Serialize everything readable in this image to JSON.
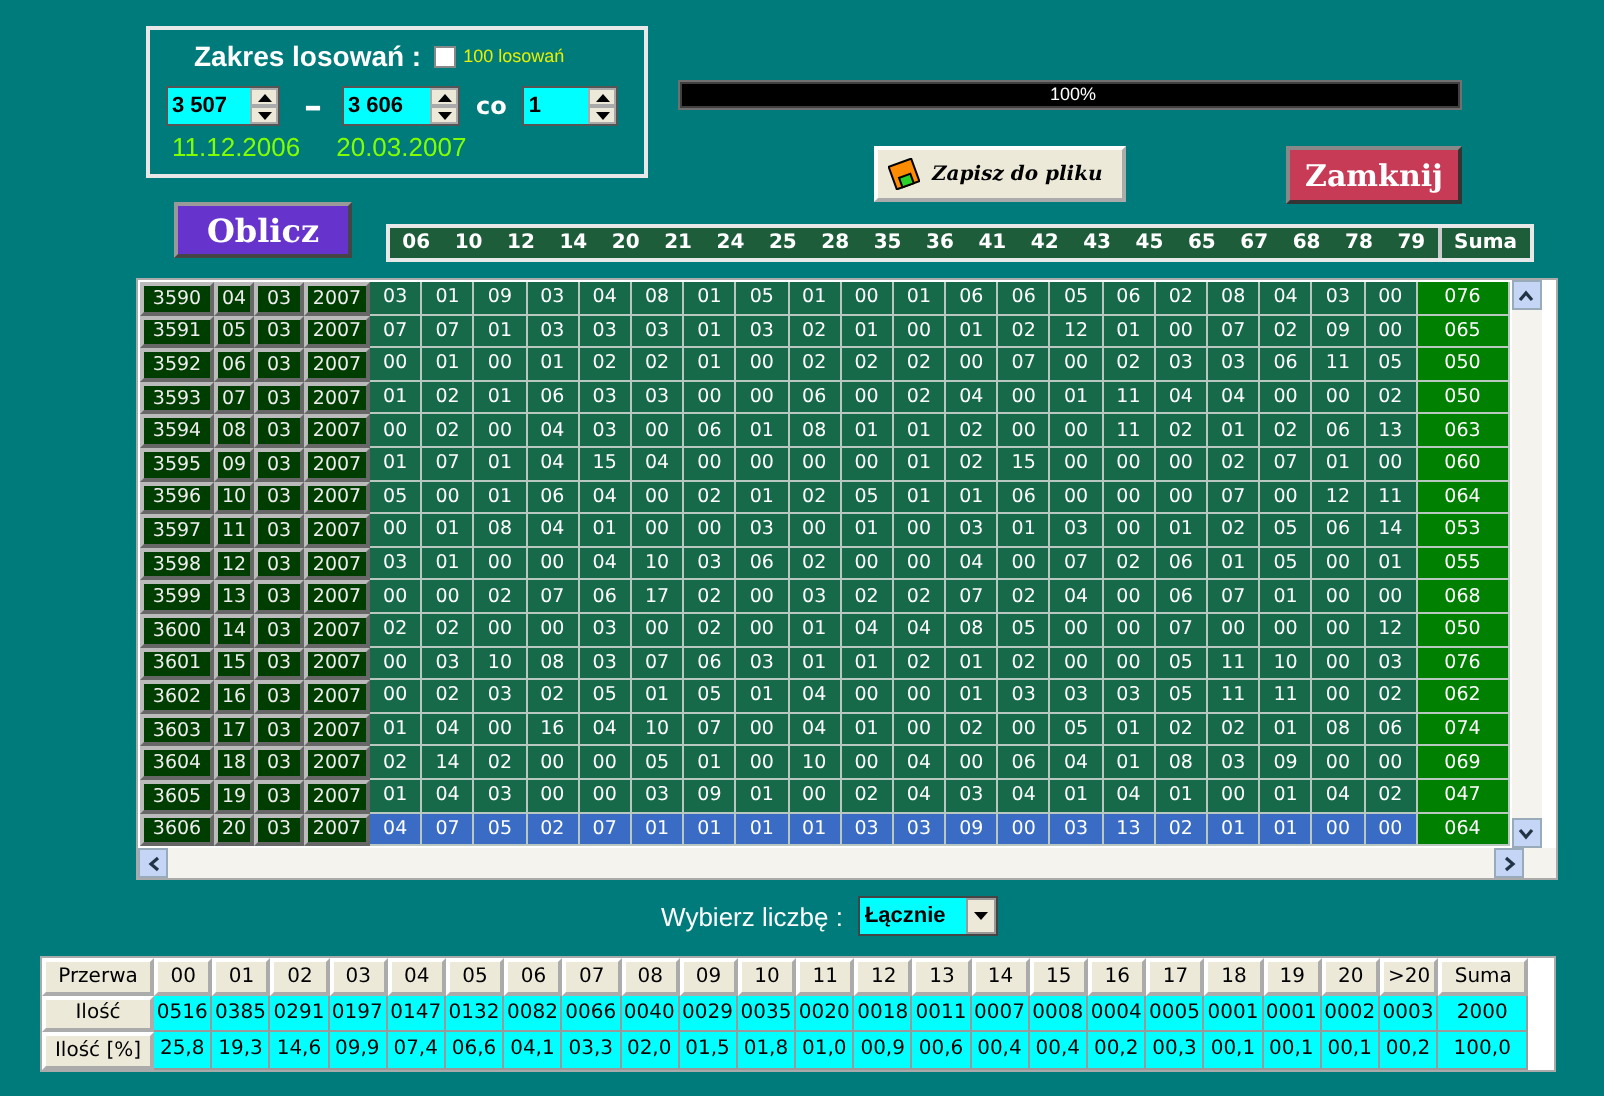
{
  "range_panel": {
    "title": "Zakres losowań :",
    "checkbox": {
      "label": "100 losowań",
      "checked": false
    },
    "from": "3 507",
    "separator": "–",
    "to": "3 606",
    "step_label": "co",
    "step": "1",
    "date_from": "11.12.2006",
    "date_to": "20.03.2007"
  },
  "progress": {
    "level": 1,
    "text": "100%"
  },
  "buttons": {
    "save": "Zapisz do pliku",
    "close": "Zamknij",
    "calculate": "Oblicz"
  },
  "columns": [
    "06",
    "10",
    "12",
    "14",
    "20",
    "21",
    "24",
    "25",
    "28",
    "35",
    "36",
    "41",
    "42",
    "43",
    "45",
    "65",
    "67",
    "68",
    "78",
    "79"
  ],
  "sum_label": "Suma",
  "rows": [
    {
      "id": "3590",
      "day": "04",
      "month": "03",
      "year": "2007",
      "values": [
        "03",
        "01",
        "09",
        "03",
        "04",
        "08",
        "01",
        "05",
        "01",
        "00",
        "01",
        "06",
        "06",
        "05",
        "06",
        "02",
        "08",
        "04",
        "03",
        "00"
      ],
      "sum": "076",
      "selected": false
    },
    {
      "id": "3591",
      "day": "05",
      "month": "03",
      "year": "2007",
      "values": [
        "07",
        "07",
        "01",
        "03",
        "03",
        "03",
        "01",
        "03",
        "02",
        "01",
        "00",
        "01",
        "02",
        "12",
        "01",
        "00",
        "07",
        "02",
        "09",
        "00"
      ],
      "sum": "065",
      "selected": false
    },
    {
      "id": "3592",
      "day": "06",
      "month": "03",
      "year": "2007",
      "values": [
        "00",
        "01",
        "00",
        "01",
        "02",
        "02",
        "01",
        "00",
        "02",
        "02",
        "02",
        "00",
        "07",
        "00",
        "02",
        "03",
        "03",
        "06",
        "11",
        "05"
      ],
      "sum": "050",
      "selected": false
    },
    {
      "id": "3593",
      "day": "07",
      "month": "03",
      "year": "2007",
      "values": [
        "01",
        "02",
        "01",
        "06",
        "03",
        "03",
        "00",
        "00",
        "06",
        "00",
        "02",
        "04",
        "00",
        "01",
        "11",
        "04",
        "04",
        "00",
        "00",
        "02"
      ],
      "sum": "050",
      "selected": false
    },
    {
      "id": "3594",
      "day": "08",
      "month": "03",
      "year": "2007",
      "values": [
        "00",
        "02",
        "00",
        "04",
        "03",
        "00",
        "06",
        "01",
        "08",
        "01",
        "01",
        "02",
        "00",
        "00",
        "11",
        "02",
        "01",
        "02",
        "06",
        "13"
      ],
      "sum": "063",
      "selected": false
    },
    {
      "id": "3595",
      "day": "09",
      "month": "03",
      "year": "2007",
      "values": [
        "01",
        "07",
        "01",
        "04",
        "15",
        "04",
        "00",
        "00",
        "00",
        "00",
        "01",
        "02",
        "15",
        "00",
        "00",
        "00",
        "02",
        "07",
        "01",
        "00"
      ],
      "sum": "060",
      "selected": false
    },
    {
      "id": "3596",
      "day": "10",
      "month": "03",
      "year": "2007",
      "values": [
        "05",
        "00",
        "01",
        "06",
        "04",
        "00",
        "02",
        "01",
        "02",
        "05",
        "01",
        "01",
        "06",
        "00",
        "00",
        "00",
        "07",
        "00",
        "12",
        "11"
      ],
      "sum": "064",
      "selected": false
    },
    {
      "id": "3597",
      "day": "11",
      "month": "03",
      "year": "2007",
      "values": [
        "00",
        "01",
        "08",
        "04",
        "01",
        "00",
        "00",
        "03",
        "00",
        "01",
        "00",
        "03",
        "01",
        "03",
        "00",
        "01",
        "02",
        "05",
        "06",
        "14"
      ],
      "sum": "053",
      "selected": false
    },
    {
      "id": "3598",
      "day": "12",
      "month": "03",
      "year": "2007",
      "values": [
        "03",
        "01",
        "00",
        "00",
        "04",
        "10",
        "03",
        "06",
        "02",
        "00",
        "00",
        "04",
        "00",
        "07",
        "02",
        "06",
        "01",
        "05",
        "00",
        "01"
      ],
      "sum": "055",
      "selected": false
    },
    {
      "id": "3599",
      "day": "13",
      "month": "03",
      "year": "2007",
      "values": [
        "00",
        "00",
        "02",
        "07",
        "06",
        "17",
        "02",
        "00",
        "03",
        "02",
        "02",
        "07",
        "02",
        "04",
        "00",
        "06",
        "07",
        "01",
        "00",
        "00"
      ],
      "sum": "068",
      "selected": false
    },
    {
      "id": "3600",
      "day": "14",
      "month": "03",
      "year": "2007",
      "values": [
        "02",
        "02",
        "00",
        "00",
        "03",
        "00",
        "02",
        "00",
        "01",
        "04",
        "04",
        "08",
        "05",
        "00",
        "00",
        "07",
        "00",
        "00",
        "00",
        "12"
      ],
      "sum": "050",
      "selected": false
    },
    {
      "id": "3601",
      "day": "15",
      "month": "03",
      "year": "2007",
      "values": [
        "00",
        "03",
        "10",
        "08",
        "03",
        "07",
        "06",
        "03",
        "01",
        "01",
        "02",
        "01",
        "02",
        "00",
        "00",
        "05",
        "11",
        "10",
        "00",
        "03"
      ],
      "sum": "076",
      "selected": false
    },
    {
      "id": "3602",
      "day": "16",
      "month": "03",
      "year": "2007",
      "values": [
        "00",
        "02",
        "03",
        "02",
        "05",
        "01",
        "05",
        "01",
        "04",
        "00",
        "00",
        "01",
        "03",
        "03",
        "03",
        "05",
        "11",
        "11",
        "00",
        "02"
      ],
      "sum": "062",
      "selected": false
    },
    {
      "id": "3603",
      "day": "17",
      "month": "03",
      "year": "2007",
      "values": [
        "01",
        "04",
        "00",
        "16",
        "04",
        "10",
        "07",
        "00",
        "04",
        "01",
        "00",
        "02",
        "00",
        "05",
        "01",
        "02",
        "02",
        "01",
        "08",
        "06"
      ],
      "sum": "074",
      "selected": false
    },
    {
      "id": "3604",
      "day": "18",
      "month": "03",
      "year": "2007",
      "values": [
        "02",
        "14",
        "02",
        "00",
        "00",
        "05",
        "01",
        "00",
        "10",
        "00",
        "04",
        "00",
        "06",
        "04",
        "01",
        "08",
        "03",
        "09",
        "00",
        "00"
      ],
      "sum": "069",
      "selected": false
    },
    {
      "id": "3605",
      "day": "19",
      "month": "03",
      "year": "2007",
      "values": [
        "01",
        "04",
        "03",
        "00",
        "00",
        "03",
        "09",
        "01",
        "00",
        "02",
        "04",
        "03",
        "04",
        "01",
        "04",
        "01",
        "00",
        "01",
        "04",
        "02"
      ],
      "sum": "047",
      "selected": false
    },
    {
      "id": "3606",
      "day": "20",
      "month": "03",
      "year": "2007",
      "values": [
        "04",
        "07",
        "05",
        "02",
        "07",
        "01",
        "01",
        "01",
        "01",
        "03",
        "03",
        "09",
        "00",
        "03",
        "13",
        "02",
        "01",
        "01",
        "00",
        "00"
      ],
      "sum": "064",
      "selected": true
    }
  ],
  "picker": {
    "label": "Wybierz liczbę :",
    "value": "Łącznie"
  },
  "stats": {
    "header": [
      "Przerwa",
      "00",
      "01",
      "02",
      "03",
      "04",
      "05",
      "06",
      "07",
      "08",
      "09",
      "10",
      "11",
      "12",
      "13",
      "14",
      "15",
      "16",
      "17",
      "18",
      "19",
      "20",
      ">20",
      "Suma"
    ],
    "rows": [
      {
        "label": "Ilość",
        "values": [
          "0516",
          "0385",
          "0291",
          "0197",
          "0147",
          "0132",
          "0082",
          "0066",
          "0040",
          "0029",
          "0035",
          "0020",
          "0018",
          "0011",
          "0007",
          "0008",
          "0004",
          "0005",
          "0001",
          "0001",
          "0002",
          "0003",
          "2000"
        ]
      },
      {
        "label": "Ilość [%]",
        "values": [
          "25,8",
          "19,3",
          "14,6",
          "09,9",
          "07,4",
          "06,6",
          "04,1",
          "03,3",
          "02,0",
          "01,5",
          "01,8",
          "01,0",
          "00,9",
          "00,6",
          "00,4",
          "00,4",
          "00,2",
          "00,3",
          "00,1",
          "00,1",
          "00,1",
          "00,2",
          "100,0"
        ]
      }
    ]
  }
}
